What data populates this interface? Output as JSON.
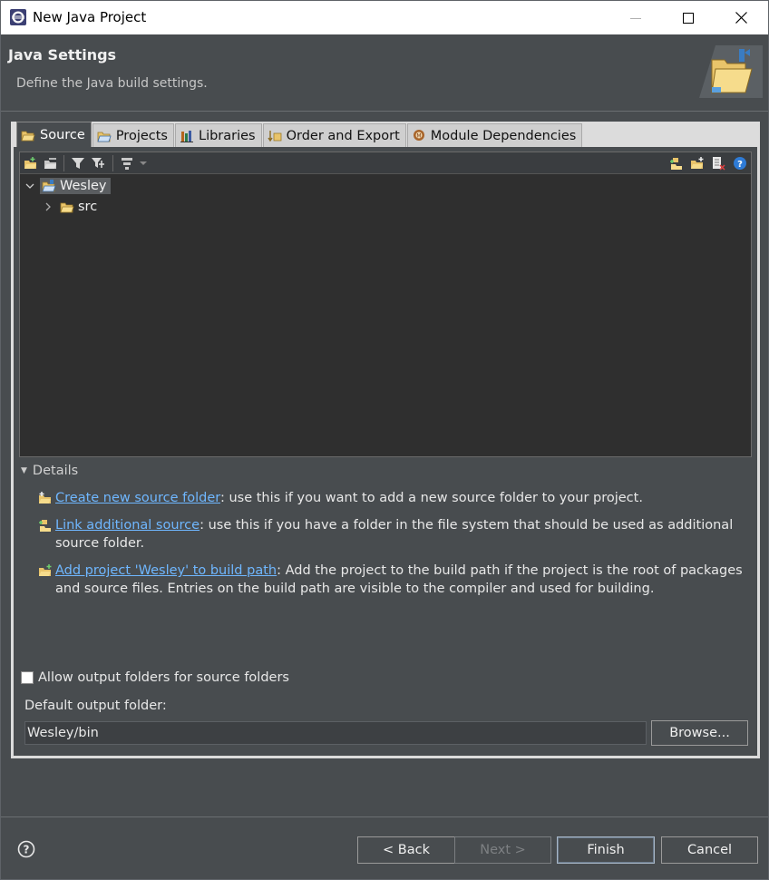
{
  "window": {
    "title": "New Java Project",
    "minimize_glyph": "—",
    "maximize_glyph": "☐",
    "close_glyph": "✕"
  },
  "header": {
    "title": "Java Settings",
    "description": "Define the Java build settings."
  },
  "tabs": [
    {
      "label": "Source",
      "icon": "source-folder-icon",
      "active": true
    },
    {
      "label": "Projects",
      "icon": "projects-icon",
      "active": false
    },
    {
      "label": "Libraries",
      "icon": "libraries-icon",
      "active": false
    },
    {
      "label": "Order and Export",
      "icon": "order-export-icon",
      "active": false
    },
    {
      "label": "Module Dependencies",
      "icon": "module-icon",
      "active": false
    }
  ],
  "tree": {
    "project": "Wesley",
    "children": [
      {
        "label": "src"
      }
    ]
  },
  "details": {
    "heading": "Details",
    "items": [
      {
        "link": "Create new source folder",
        "text": ": use this if you want to add a new source folder to your project."
      },
      {
        "link": "Link additional source",
        "text": ": use this if you have a folder in the file system that should be used as additional source folder."
      },
      {
        "link": "Add project 'Wesley' to build path",
        "text": ": Add the project to the build path if the project is the root of packages and source files. Entries on the build path are visible to the compiler and used for building."
      }
    ]
  },
  "output": {
    "allow_label": "Allow output folders for source folders",
    "allow_checked": false,
    "default_label": "Default output folder:",
    "default_value": "Wesley/bin",
    "browse_label": "Browse..."
  },
  "buttons": {
    "back": "< Back",
    "next": "Next >",
    "finish": "Finish",
    "cancel": "Cancel"
  },
  "colors": {
    "background": "#484c4f",
    "tree_bg": "#2f2f2f",
    "link": "#6fb7ff",
    "titlebar": "#ffffff"
  }
}
